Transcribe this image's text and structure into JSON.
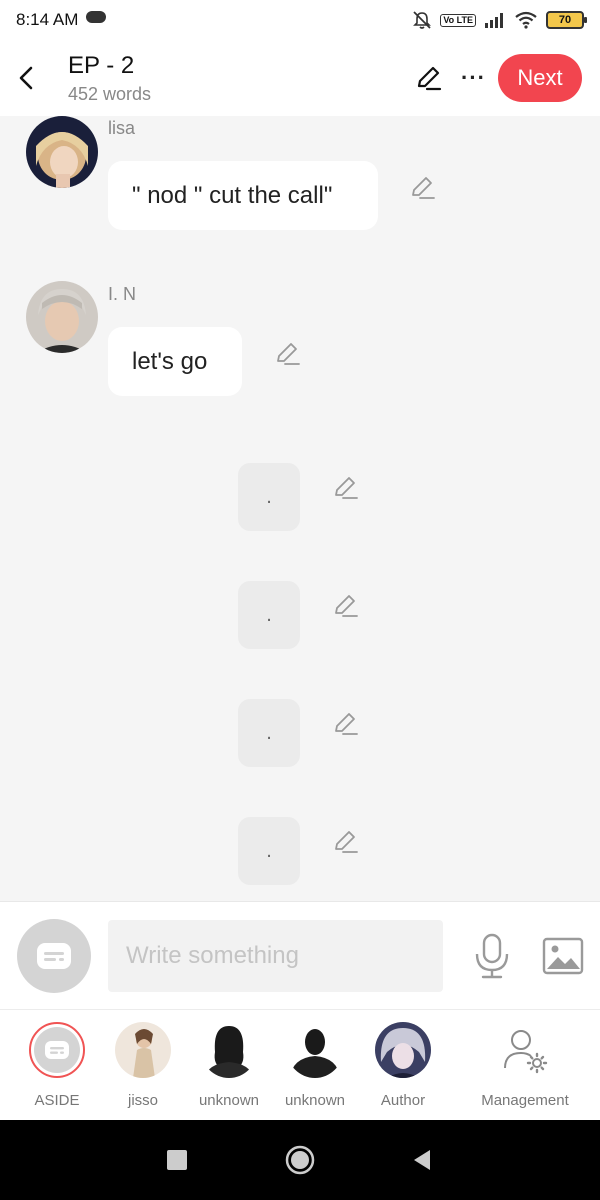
{
  "status_bar": {
    "time": "8:14 AM",
    "volte": "Vo LTE",
    "battery": "70"
  },
  "header": {
    "title": "EP - 2",
    "word_count": "452 words",
    "next_label": "Next"
  },
  "messages": [
    {
      "speaker": "lisa",
      "text": "\" nod \" cut the call\""
    },
    {
      "speaker": "I. N",
      "text": "let's go"
    }
  ],
  "aside_messages": [
    ".",
    ".",
    ".",
    "."
  ],
  "input": {
    "placeholder": "Write something"
  },
  "characters": [
    {
      "label": "ASIDE"
    },
    {
      "label": "jisso"
    },
    {
      "label": "unknown"
    },
    {
      "label": "unknown"
    },
    {
      "label": "Author"
    },
    {
      "label": "Management"
    }
  ],
  "colors": {
    "accent": "#f2454f",
    "background": "#f5f5f5"
  }
}
